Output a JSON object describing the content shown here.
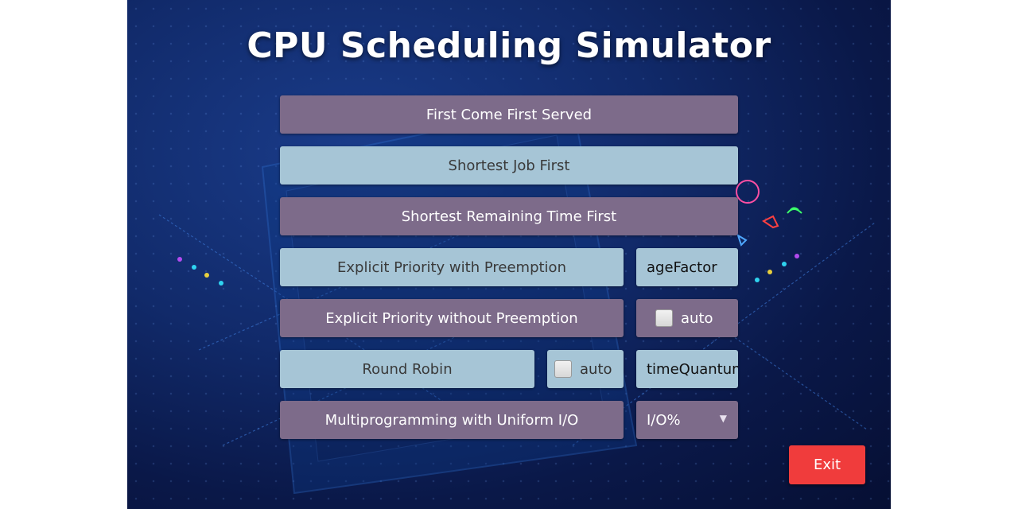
{
  "title": "CPU Scheduling Simulator",
  "buttons": {
    "fcfs": "First Come First Served",
    "sjf": "Shortest Job First",
    "srtf": "Shortest Remaining Time First",
    "priority_preempt": "Explicit Priority with Preemption",
    "priority_nonpreempt": "Explicit Priority without Preemption",
    "round_robin": "Round Robin",
    "multiprogramming": "Multiprogramming with Uniform I/O",
    "exit": "Exit"
  },
  "fields": {
    "age_factor": "ageFactor",
    "time_quantum": "timeQuantum"
  },
  "checkboxes": {
    "priority_auto": "auto",
    "rr_auto": "auto"
  },
  "select": {
    "io_percent": "I/O%"
  },
  "colors": {
    "purple_button": "#7d6b8a",
    "blue_button": "#a6c5d6",
    "exit_button": "#f03c3c"
  }
}
